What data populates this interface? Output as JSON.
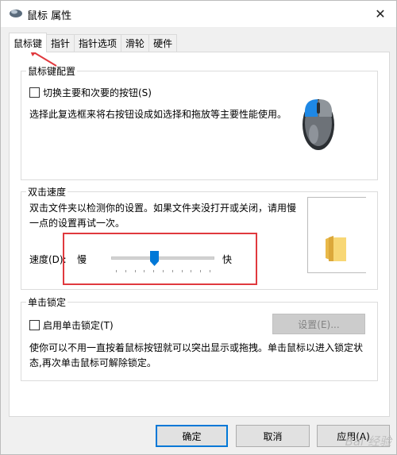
{
  "window": {
    "title": "鼠标 属性",
    "close_glyph": "✕"
  },
  "tabs": [
    {
      "label": "鼠标键",
      "active": true
    },
    {
      "label": "指针",
      "active": false
    },
    {
      "label": "指针选项",
      "active": false
    },
    {
      "label": "滑轮",
      "active": false
    },
    {
      "label": "硬件",
      "active": false
    }
  ],
  "button_config": {
    "group_title": "鼠标键配置",
    "switch_label": "切换主要和次要的按钮(S)",
    "switch_checked": false,
    "description": "选择此复选框来将右按钮设成如选择和拖放等主要性能使用。"
  },
  "double_click": {
    "group_title": "双击速度",
    "description": "双击文件夹以检测你的设置。如果文件夹没打开或关闭，请用慢一点的设置再试一次。",
    "speed_label": "速度(D):",
    "slow_label": "慢",
    "fast_label": "快",
    "speed_value_fraction": 0.42
  },
  "click_lock": {
    "group_title": "单击锁定",
    "enable_label": "启用单击锁定(T)",
    "enable_checked": false,
    "settings_button": "设置(E)...",
    "description": "使你可以不用一直按着鼠标按钮就可以突出显示或拖拽。单击鼠标以进入锁定状态,再次单击鼠标可解除锁定。"
  },
  "footer": {
    "ok": "确定",
    "cancel": "取消",
    "apply": "应用(A)"
  },
  "watermark": "Bai 经验"
}
